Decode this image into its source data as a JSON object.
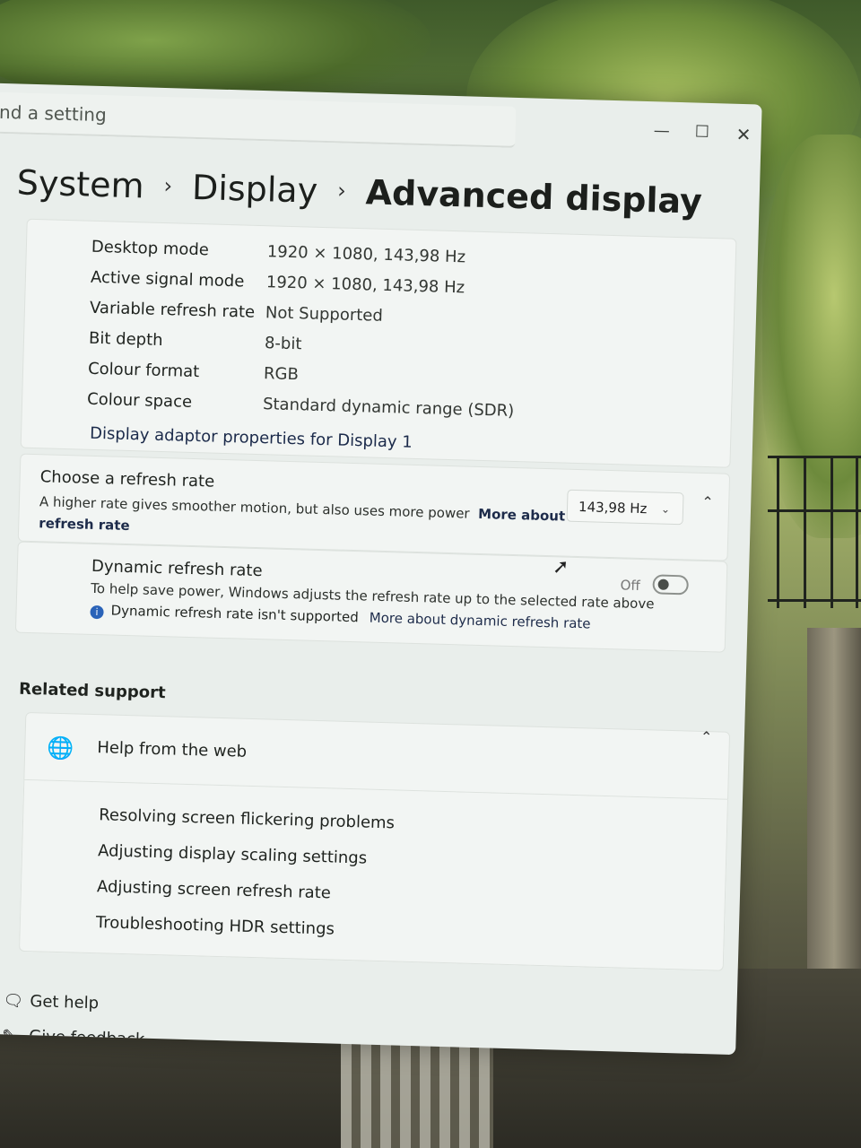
{
  "window": {
    "search_placeholder": "nd a setting",
    "controls": {
      "minimize": "—",
      "maximize": "☐",
      "close": "✕"
    }
  },
  "breadcrumb": {
    "items": [
      "System",
      "Display",
      "Advanced display"
    ],
    "separator": "›"
  },
  "display_info": {
    "rows": [
      {
        "label": "Desktop mode",
        "value": "1920 × 1080, 143,98 Hz"
      },
      {
        "label": "Active signal mode",
        "value": "1920 × 1080, 143,98 Hz"
      },
      {
        "label": "Variable refresh rate",
        "value": "Not Supported"
      },
      {
        "label": "Bit depth",
        "value": "8-bit"
      },
      {
        "label": "Colour format",
        "value": "RGB"
      },
      {
        "label": "Colour space",
        "value": "Standard dynamic range (SDR)"
      }
    ],
    "adapter_link": "Display adaptor properties for Display 1"
  },
  "refresh_rate": {
    "title": "Choose a refresh rate",
    "description": "A higher rate gives smoother motion, but also uses more power",
    "more_link": "More about refresh rate",
    "selected": "143,98 Hz"
  },
  "dynamic_refresh": {
    "title": "Dynamic refresh rate",
    "description": "To help save power, Windows adjusts the refresh rate up to the selected rate above",
    "note": "Dynamic refresh rate isn't supported",
    "note_link": "More about dynamic refresh rate",
    "toggle_label": "Off",
    "toggle_on": false
  },
  "related_support": {
    "heading": "Related support",
    "help_title": "Help from the web",
    "links": [
      "Resolving screen flickering problems",
      "Adjusting display scaling settings",
      "Adjusting screen refresh rate",
      "Troubleshooting HDR settings"
    ]
  },
  "footer": {
    "get_help": "Get help",
    "give_feedback": "Give feedback"
  },
  "colors": {
    "window_bg": "#e9eeeb",
    "card_bg": "#f2f5f3",
    "link": "#1d2b4a",
    "info_icon": "#2a63b8"
  },
  "icons": {
    "globe": "globe-icon",
    "info": "info-icon",
    "get_help": "help-icon",
    "feedback": "feedback-icon"
  }
}
